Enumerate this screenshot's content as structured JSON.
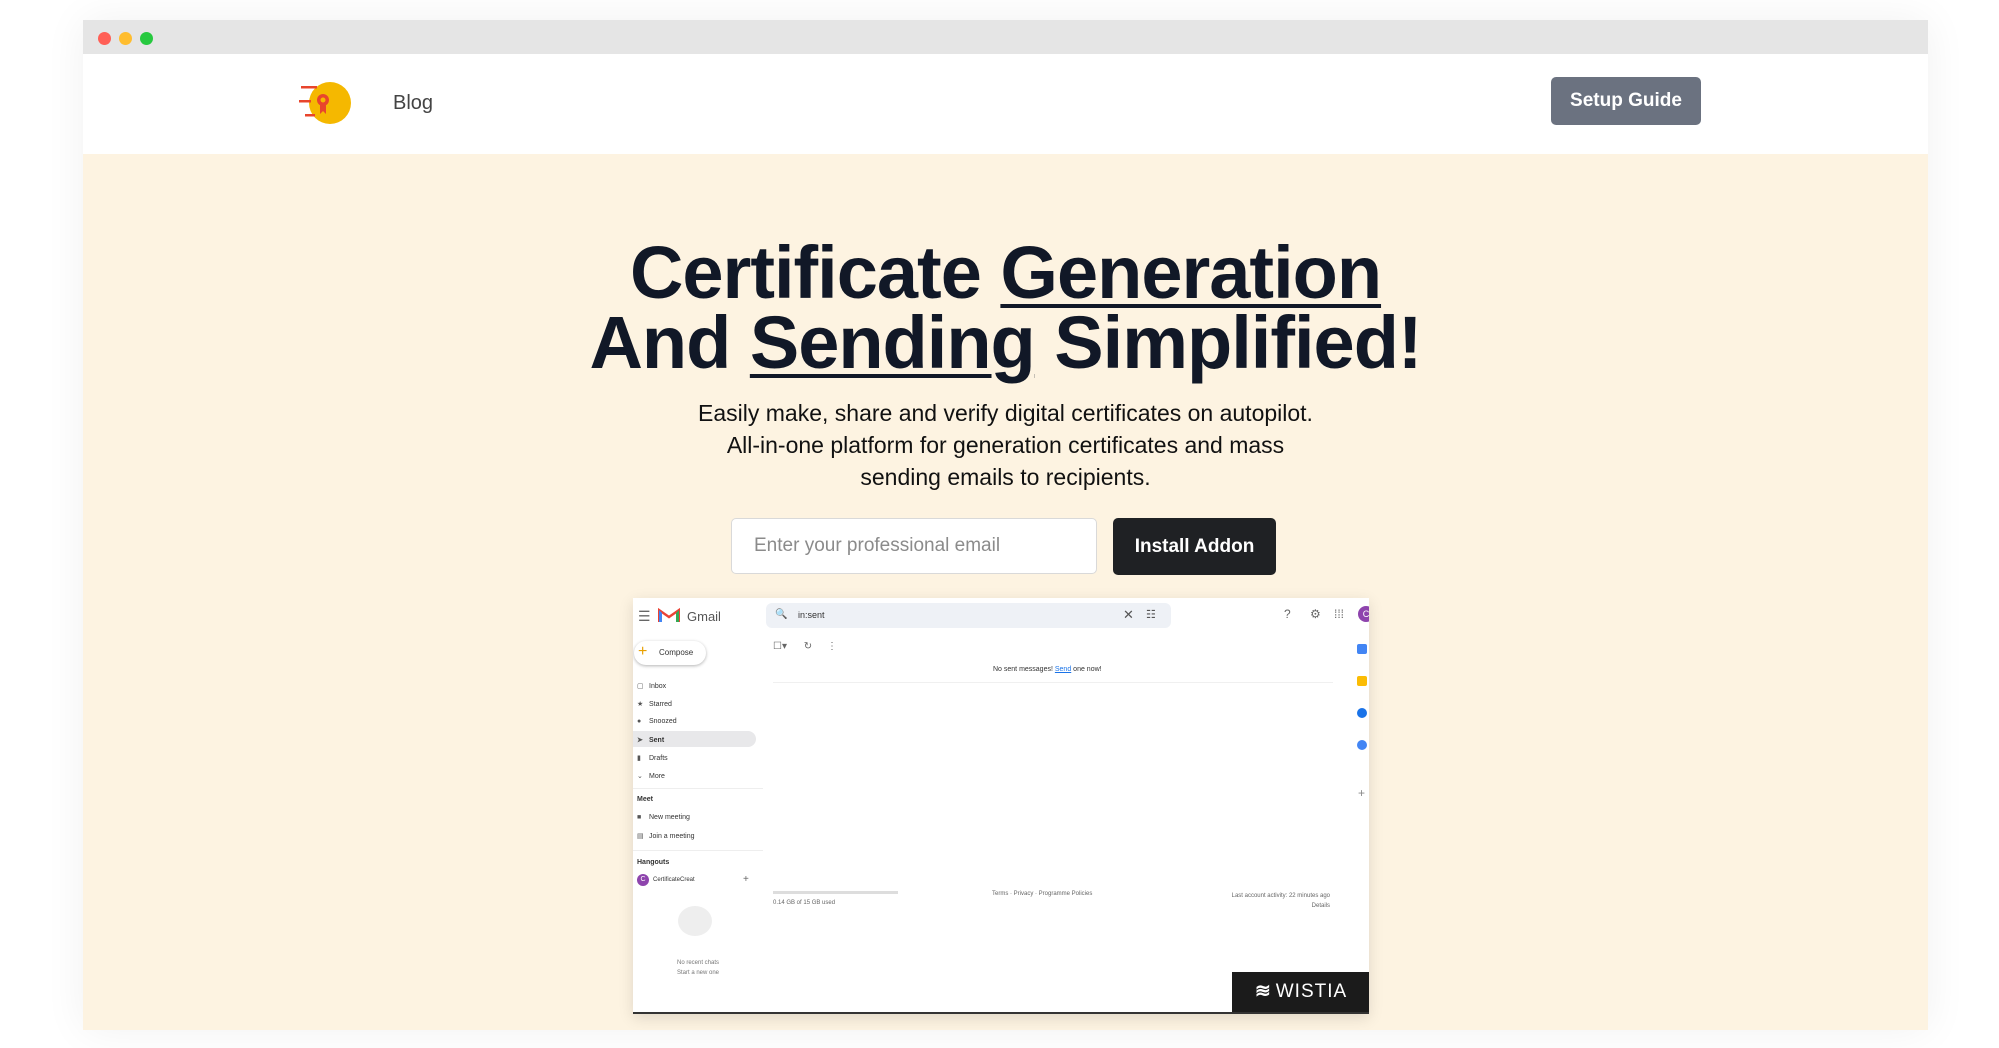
{
  "nav": {
    "blog": "Blog",
    "setup_guide": "Setup Guide"
  },
  "hero": {
    "headline_1a": "Certificate ",
    "headline_1b": "Generation",
    "headline_2a": "And ",
    "headline_2b": "Sending",
    "headline_2c": " Simplified!",
    "sub_1": "Easily make, share and verify digital certificates on autopilot.",
    "sub_2": "All-in-one platform for generation certificates and mass",
    "sub_3": "sending emails to recipients.",
    "email_placeholder": "Enter your professional email",
    "install_label": "Install Addon"
  },
  "video": {
    "gmail": {
      "app_name": "Gmail",
      "search_query": "in:sent",
      "avatar_letter": "C",
      "compose": "Compose",
      "folders": [
        "Inbox",
        "Starred",
        "Snoozed",
        "Sent",
        "Drafts",
        "More"
      ],
      "meet_title": "Meet",
      "meet_items": [
        "New meeting",
        "Join a meeting"
      ],
      "hangouts_title": "Hangouts",
      "hangouts_contact": "CertificateCreat",
      "no_recent_1": "No recent chats",
      "no_recent_2": "Start a new one",
      "no_sent_pre": "No sent messages! ",
      "no_sent_link": "Send",
      "no_sent_post": " one now!",
      "storage": "0.14 GB of 15 GB used",
      "terms": "Terms · Privacy · Programme Policies",
      "activity_1": "Last account activity: 22 minutes ago",
      "activity_2": "Details"
    },
    "wistia_label": "WISTIA"
  },
  "colors": {
    "hero_bg": "#fdf3e1",
    "setup_button": "#6b7280",
    "install_button": "#1f2124",
    "logo_yellow": "#f5b800",
    "logo_red": "#e8452c"
  }
}
